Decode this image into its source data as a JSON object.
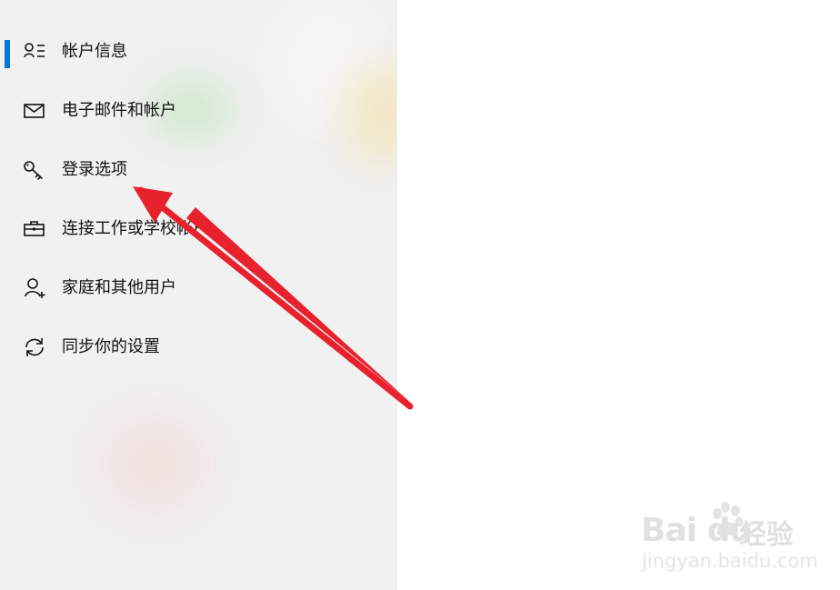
{
  "sidebar": {
    "items": [
      {
        "label": "帐户信息",
        "icon": "account-info-icon",
        "selected": true
      },
      {
        "label": "电子邮件和帐户",
        "icon": "mail-icon",
        "selected": false
      },
      {
        "label": "登录选项",
        "icon": "key-icon",
        "selected": false
      },
      {
        "label": "连接工作或学校帐户",
        "icon": "briefcase-icon",
        "selected": false
      },
      {
        "label": "家庭和其他用户",
        "icon": "add-user-icon",
        "selected": false
      },
      {
        "label": "同步你的设置",
        "icon": "sync-icon",
        "selected": false
      }
    ]
  },
  "overlay": {
    "annotation": "red-arrow",
    "color": "#e8222d"
  },
  "watermark": {
    "main": "Bai du",
    "experience": "经验",
    "domain": "jingyan.baidu.com"
  },
  "colors": {
    "sidebar_bg": "#f1f1f1",
    "accent": "#0078d7",
    "text": "#111111"
  }
}
